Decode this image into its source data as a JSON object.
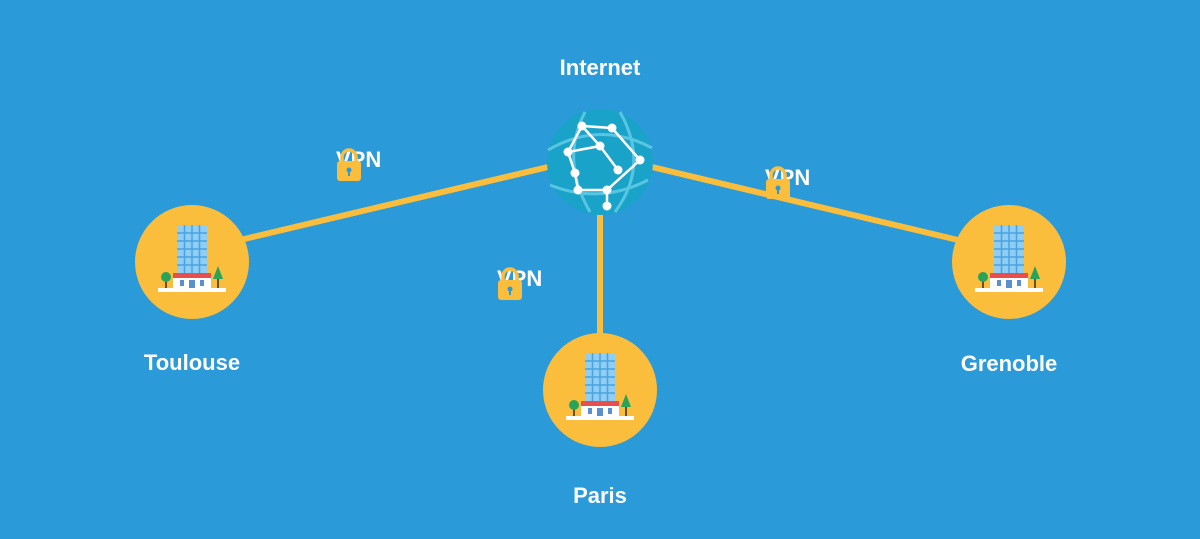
{
  "colors": {
    "background": "#2b9ad9",
    "link": "#fbbd3c",
    "node": "#fbbd3c",
    "globe": "#1aa3c8",
    "text": "#ffffff"
  },
  "internet": {
    "label": "Internet",
    "icon": "globe-network-icon"
  },
  "sites": [
    {
      "id": "toulouse",
      "label": "Toulouse",
      "icon": "office-building-icon"
    },
    {
      "id": "paris",
      "label": "Paris",
      "icon": "office-building-icon"
    },
    {
      "id": "grenoble",
      "label": "Grenoble",
      "icon": "office-building-icon"
    }
  ],
  "links": [
    {
      "from": "toulouse",
      "to": "internet",
      "label": "VPN",
      "icon": "padlock-icon"
    },
    {
      "from": "paris",
      "to": "internet",
      "label": "VPN",
      "icon": "padlock-icon"
    },
    {
      "from": "grenoble",
      "to": "internet",
      "label": "VPN",
      "icon": "padlock-icon"
    }
  ]
}
